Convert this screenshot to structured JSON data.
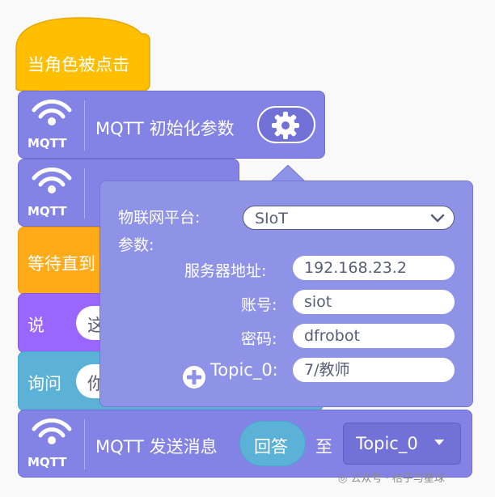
{
  "colors": {
    "hat_yellow": "#ffbf00",
    "mqtt_purple": "#8383e6",
    "wait_orange": "#ffab19",
    "looks_purple": "#9966ff",
    "sensing_cyan": "#5cb1d6"
  },
  "blocks": {
    "hat_label": "当角色被点击",
    "mqtt_icon_label": "MQTT",
    "init_label": "MQTT 初始化参数",
    "settings_icon": "gear-icon",
    "wait_label": "等待直到",
    "wait_tail": "",
    "say_label": "说",
    "say_input": "这",
    "ask_label": "询问",
    "ask_input": "你",
    "send_label": "MQTT 发送消息",
    "send_answer": "回答",
    "send_to": "至",
    "send_topic": "Topic_0"
  },
  "popup": {
    "platform_label": "物联网平台:",
    "platform_value": "SIoT",
    "params_label": "参数:",
    "server_label": "服务器地址:",
    "server_value": "192.168.23.2",
    "account_label": "账号:",
    "account_value": "siot",
    "password_label": "密码:",
    "password_value": "dfrobot",
    "topic_label": "Topic_0:",
    "topic_value": "7/教师"
  },
  "watermark": "公众号 · 桔子与星球"
}
